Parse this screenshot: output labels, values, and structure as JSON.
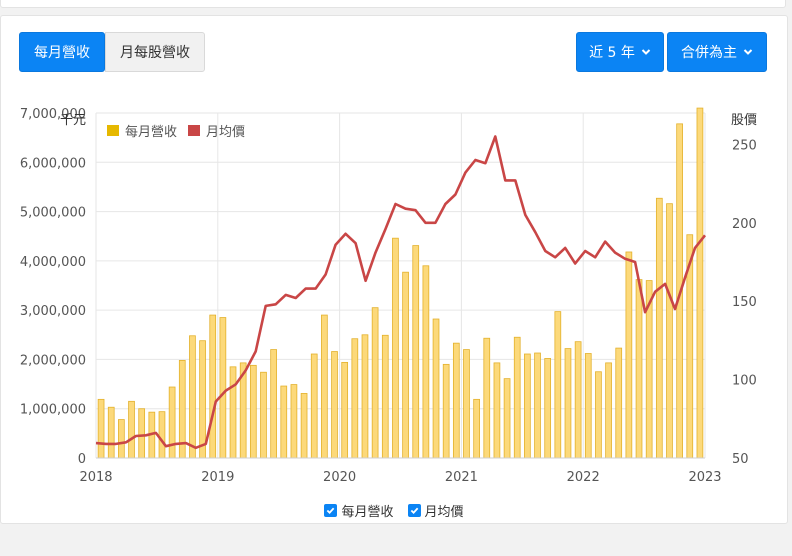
{
  "tabs": [
    {
      "label": "每月營收",
      "active": true
    },
    {
      "label": "月每股營收",
      "active": false
    }
  ],
  "dropdowns": [
    {
      "label": "近 5 年"
    },
    {
      "label": "合併為主"
    }
  ],
  "colors": {
    "primary": "#0b84f4",
    "bar_fill": "#fcd97a",
    "bar_stroke": "#e3b12c",
    "legend_bar": "#e6b800",
    "line": "#c94646"
  },
  "bottom_legend": [
    {
      "label": "每月營收",
      "checked": true
    },
    {
      "label": "月均價",
      "checked": true
    }
  ],
  "chart_data": {
    "type": "bar+line",
    "left_axis": {
      "unit": "千元",
      "ylim": [
        0,
        7000000
      ],
      "ticks": [
        0,
        1000000,
        2000000,
        3000000,
        4000000,
        5000000,
        6000000,
        7000000
      ],
      "tick_labels": [
        "0",
        "1,000,000",
        "2,000,000",
        "3,000,000",
        "4,000,000",
        "5,000,000",
        "6,000,000",
        "7,000,000"
      ]
    },
    "right_axis": {
      "unit": "股價",
      "ylim": [
        50,
        270
      ],
      "ticks": [
        50,
        100,
        150,
        200,
        250
      ],
      "tick_labels": [
        "50",
        "100",
        "150",
        "200",
        "250"
      ]
    },
    "x_axis": {
      "start": "2018-01",
      "end": "2023-01",
      "ticks": [
        "2018-01",
        "2019-01",
        "2020-01",
        "2021-01",
        "2022-01",
        "2023-01"
      ],
      "tick_labels": [
        "2018",
        "2019",
        "2020",
        "2021",
        "2022",
        "2023"
      ]
    },
    "grid": true,
    "legend_position": "top-left",
    "series": [
      {
        "name": "每月營收",
        "type": "bar",
        "axis": "left",
        "months": [
          "2018-01",
          "2018-02",
          "2018-03",
          "2018-04",
          "2018-05",
          "2018-06",
          "2018-07",
          "2018-08",
          "2018-09",
          "2018-10",
          "2018-11",
          "2018-12",
          "2019-01",
          "2019-02",
          "2019-03",
          "2019-04",
          "2019-05",
          "2019-06",
          "2019-07",
          "2019-08",
          "2019-09",
          "2019-10",
          "2019-11",
          "2019-12",
          "2020-01",
          "2020-02",
          "2020-03",
          "2020-04",
          "2020-05",
          "2020-06",
          "2020-07",
          "2020-08",
          "2020-09",
          "2020-10",
          "2020-11",
          "2020-12",
          "2021-01",
          "2021-02",
          "2021-03",
          "2021-04",
          "2021-05",
          "2021-06",
          "2021-07",
          "2021-08",
          "2021-09",
          "2021-10",
          "2021-11",
          "2021-12",
          "2022-01",
          "2022-02",
          "2022-03",
          "2022-04",
          "2022-05",
          "2022-06",
          "2022-07",
          "2022-08",
          "2022-09",
          "2022-10",
          "2022-11",
          "2022-12"
        ],
        "values": [
          1190000,
          1030000,
          780000,
          1150000,
          1000000,
          930000,
          940000,
          1440000,
          1980000,
          2480000,
          2380000,
          2900000,
          2850000,
          1850000,
          1930000,
          1880000,
          1740000,
          2200000,
          1460000,
          1490000,
          1310000,
          2110000,
          2900000,
          2160000,
          1940000,
          2420000,
          2500000,
          3050000,
          2490000,
          4460000,
          3770000,
          4310000,
          3900000,
          2820000,
          1900000,
          2330000,
          2200000,
          1190000,
          2430000,
          1930000,
          1610000,
          2450000,
          2110000,
          2130000,
          2020000,
          2970000,
          2220000,
          2360000,
          2120000,
          1750000,
          1930000,
          2230000,
          4180000,
          3620000,
          3600000,
          5270000,
          5160000,
          6780000,
          4530000,
          7100000
        ]
      },
      {
        "name": "月均價",
        "type": "line",
        "axis": "right",
        "values": [
          59.5,
          59.0,
          59.0,
          60.0,
          64.0,
          64.5,
          66.0,
          57.5,
          59.0,
          59.5,
          56.5,
          59.0,
          86.0,
          93.0,
          97.0,
          106.0,
          118.0,
          147.0,
          148.0,
          154.0,
          152.0,
          158.0,
          158.0,
          167.0,
          186.0,
          193.0,
          187.0,
          163.0,
          181.0,
          196.0,
          212.0,
          209.0,
          208.0,
          200.0,
          200.0,
          212.0,
          218.0,
          232.0,
          240.0,
          238.0,
          255.0,
          227.0,
          227.0,
          205.0,
          194.0,
          182.0,
          178.0,
          184.0,
          174.0,
          182.0,
          178.0,
          188.0,
          181.0,
          177.0,
          175.0,
          143.0,
          156.0,
          161.0,
          145.0,
          165.0,
          184.0,
          192.0
        ]
      }
    ]
  }
}
